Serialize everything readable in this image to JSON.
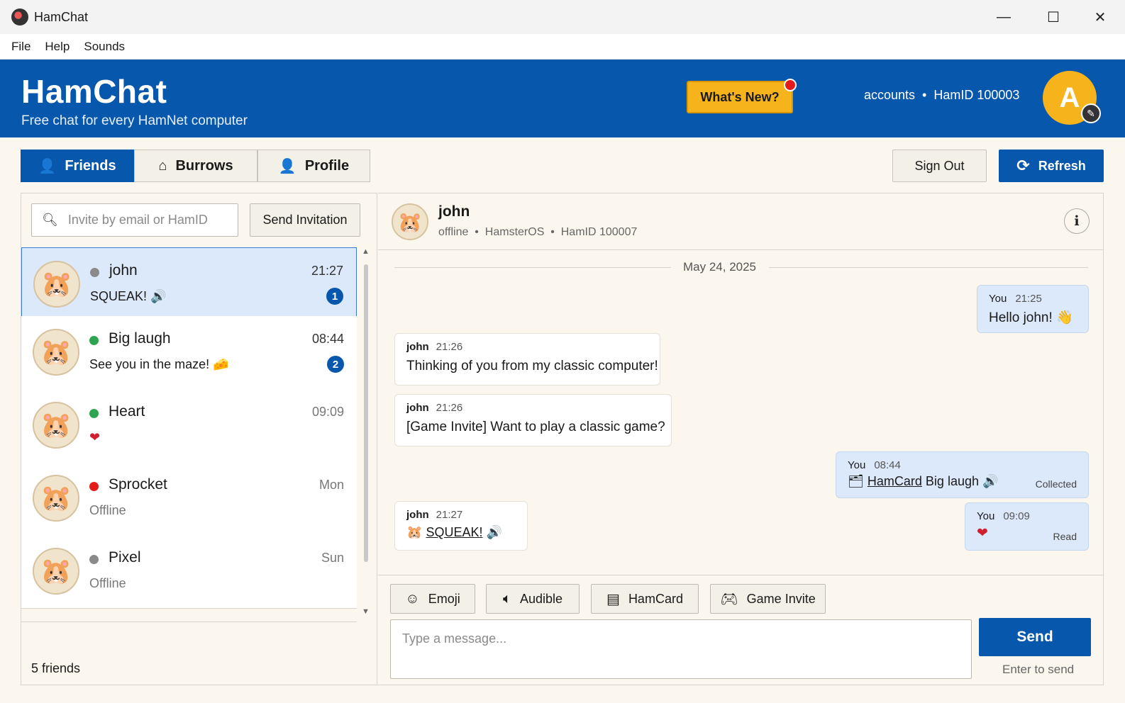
{
  "window": {
    "title": "HamChat",
    "controls": {
      "minimize": "—",
      "maximize": "☐",
      "close": "✕"
    }
  },
  "menu": [
    "File",
    "Help",
    "Sounds"
  ],
  "header": {
    "brand": "HamChat",
    "tagline": "Free chat for every HamNet computer",
    "whats_new": "What's New?",
    "account": "accounts  •  HamID 100003",
    "avatar_letter": "A",
    "colors": {
      "primary": "#0757ad",
      "accent": "#f6b31c",
      "notification": "#e41b1b"
    }
  },
  "tabs": [
    {
      "label": "Friends",
      "icon": "user-icon",
      "active": true
    },
    {
      "label": "Burrows",
      "icon": "home-icon",
      "active": false
    },
    {
      "label": "Profile",
      "icon": "user-icon",
      "active": false
    }
  ],
  "actions": {
    "sign_out": "Sign Out",
    "refresh": "Refresh"
  },
  "friends_panel": {
    "search_placeholder": "Invite by email or HamID",
    "send_invitation": "Send Invitation",
    "friends": [
      {
        "name": "john",
        "status": "offline",
        "status_color": "#8a8a8a",
        "time": "21:27",
        "preview": "SQUEAK! 🔊",
        "unread": "1",
        "selected": true
      },
      {
        "name": "Big laugh",
        "status": "online",
        "status_color": "#2da44e",
        "time": "08:44",
        "preview": "See you in the maze! 🧀",
        "unread": "2",
        "selected": false
      },
      {
        "name": "Heart",
        "status": "online",
        "status_color": "#2da44e",
        "time": "09:09",
        "preview": "❤",
        "unread": "",
        "selected": false
      },
      {
        "name": "Sprocket",
        "status": "busy",
        "status_color": "#e41b1b",
        "time": "Mon",
        "preview": "Offline",
        "unread": "",
        "selected": false
      },
      {
        "name": "Pixel",
        "status": "offline",
        "status_color": "#8a8a8a",
        "time": "Sun",
        "preview": "Offline",
        "unread": "",
        "selected": false
      }
    ],
    "count": "5 friends"
  },
  "chat": {
    "contact_name": "john",
    "contact_sub": "offline  •  HamsterOS  •  HamID 100007",
    "date": "May 24, 2025",
    "messages": [
      {
        "dir": "out",
        "who": "You",
        "time": "21:25",
        "text": "Hello john! 👋",
        "status": ""
      },
      {
        "dir": "in",
        "who": "john",
        "time": "21:26",
        "text": "Thinking of you from my classic computer!",
        "status": ""
      },
      {
        "dir": "in",
        "who": "john",
        "time": "21:26",
        "text": "[Game Invite] Want to play a classic game?",
        "status": ""
      },
      {
        "dir": "out",
        "who": "You",
        "time": "08:44",
        "link": "HamCard",
        "text": "Big laugh 🔊",
        "status": "Collected"
      },
      {
        "dir": "in",
        "who": "john",
        "time": "21:27",
        "link": "SQUEAK!",
        "text": "🔊",
        "status": ""
      },
      {
        "dir": "out",
        "who": "You",
        "time": "09:09",
        "text": "❤",
        "status": "Read"
      }
    ]
  },
  "composer": {
    "tools": [
      {
        "label": "Emoji",
        "icon": "smiley-icon"
      },
      {
        "label": "Audible",
        "icon": "speaker-icon"
      },
      {
        "label": "HamCard",
        "icon": "card-icon"
      },
      {
        "label": "Game Invite",
        "icon": "gamepad-icon"
      }
    ],
    "placeholder": "Type a message...",
    "send": "Send",
    "hint": "Enter to send"
  }
}
